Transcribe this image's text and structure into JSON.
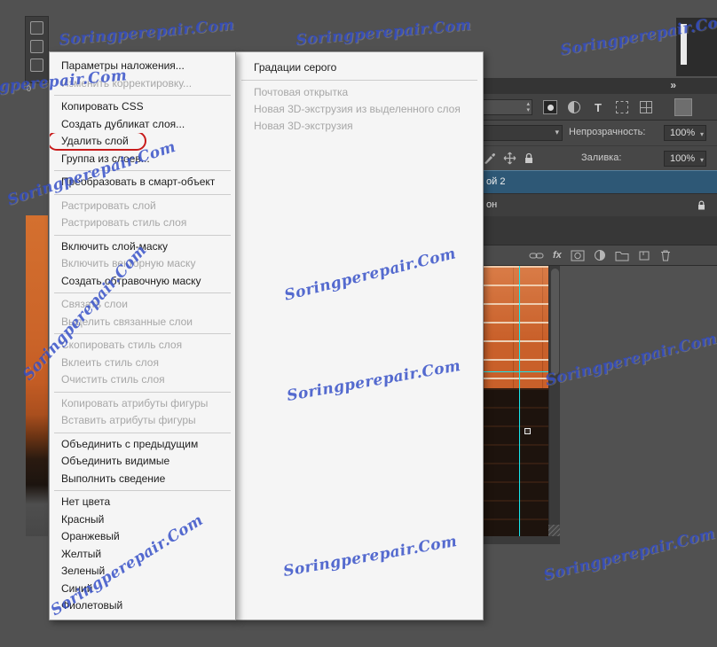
{
  "watermark": {
    "text": "Soringperepair.Com",
    "color": "#2f4ac6"
  },
  "ruler": {
    "origin_label": "0"
  },
  "icons": {
    "collapse_panels": "»",
    "dropdown_arrow": "▾",
    "stepper_up": "▴",
    "stepper_down": "▾",
    "text_tool": "T",
    "fx": "fx"
  },
  "layers_panel": {
    "opacity_label": "Непрозрачность:",
    "opacity_value": "100%",
    "fill_label": "Заливка:",
    "fill_value": "100%",
    "selected_layer_fragment": "ой 2",
    "background_layer_fragment": "он"
  },
  "colors": {
    "highlight_red": "#c81b1b",
    "selected_layer_blue": "#2e5876",
    "guide_cyan": "#18e6ee"
  },
  "context_menu": {
    "items": [
      {
        "id": "blending-options",
        "label": "Параметры наложения...",
        "enabled": true
      },
      {
        "id": "edit-adjustment",
        "label": "Изменить корректировку...",
        "enabled": false
      },
      {
        "type": "separator"
      },
      {
        "id": "copy-css",
        "label": "Копировать CSS",
        "enabled": true
      },
      {
        "id": "duplicate-layer",
        "label": "Создать дубликат слоя...",
        "enabled": true
      },
      {
        "id": "delete-layer",
        "label": "Удалить слой",
        "enabled": true,
        "circled": true
      },
      {
        "id": "group-from-layers",
        "label": "Группа из слоев...",
        "enabled": true
      },
      {
        "type": "separator"
      },
      {
        "id": "convert-to-smart-object",
        "label": "Преобразовать в смарт-объект",
        "enabled": true
      },
      {
        "type": "separator"
      },
      {
        "id": "rasterize-layer",
        "label": "Растрировать слой",
        "enabled": false
      },
      {
        "id": "rasterize-layer-style",
        "label": "Растрировать стиль слоя",
        "enabled": false
      },
      {
        "type": "separator"
      },
      {
        "id": "enable-layer-mask",
        "label": "Включить слой-маску",
        "enabled": true
      },
      {
        "id": "enable-vector-mask",
        "label": "Включить векторную маску",
        "enabled": false
      },
      {
        "id": "create-clipping-mask",
        "label": "Создать обтравочную маску",
        "enabled": true
      },
      {
        "type": "separator"
      },
      {
        "id": "link-layers",
        "label": "Связать слои",
        "enabled": false
      },
      {
        "id": "select-linked-layers",
        "label": "Выделить связанные слои",
        "enabled": false
      },
      {
        "type": "separator"
      },
      {
        "id": "copy-layer-style",
        "label": "Скопировать стиль слоя",
        "enabled": false
      },
      {
        "id": "paste-layer-style",
        "label": "Вклеить стиль слоя",
        "enabled": false
      },
      {
        "id": "clear-layer-style",
        "label": "Очистить стиль слоя",
        "enabled": false
      },
      {
        "type": "separator"
      },
      {
        "id": "copy-shape-attributes",
        "label": "Копировать атрибуты фигуры",
        "enabled": false
      },
      {
        "id": "paste-shape-attributes",
        "label": "Вставить атрибуты фигуры",
        "enabled": false
      },
      {
        "type": "separator"
      },
      {
        "id": "merge-down",
        "label": "Объединить с предыдущим",
        "enabled": true
      },
      {
        "id": "merge-visible",
        "label": "Объединить видимые",
        "enabled": true
      },
      {
        "id": "flatten-image",
        "label": "Выполнить сведение",
        "enabled": true
      },
      {
        "type": "separator"
      },
      {
        "id": "no-color",
        "label": "Нет цвета",
        "enabled": true
      },
      {
        "id": "red",
        "label": "Красный",
        "enabled": true
      },
      {
        "id": "orange",
        "label": "Оранжевый",
        "enabled": true
      },
      {
        "id": "yellow",
        "label": "Желтый",
        "enabled": true
      },
      {
        "id": "green",
        "label": "Зеленый",
        "enabled": true
      },
      {
        "id": "blue",
        "label": "Синий",
        "enabled": true
      },
      {
        "id": "violet",
        "label": "Фиолетовый",
        "enabled": true
      }
    ]
  },
  "secondary_menu": {
    "items": [
      {
        "id": "grayscale",
        "label": "Градации серого",
        "enabled": true
      },
      {
        "type": "separator"
      },
      {
        "id": "postcard",
        "label": "Почтовая открытка",
        "enabled": false
      },
      {
        "id": "new-3d-extrusion-from-layer",
        "label": "Новая 3D-экструзия из выделенного слоя",
        "enabled": false
      },
      {
        "id": "new-3d-extrusion",
        "label": "Новая 3D-экструзия",
        "enabled": false
      }
    ]
  }
}
